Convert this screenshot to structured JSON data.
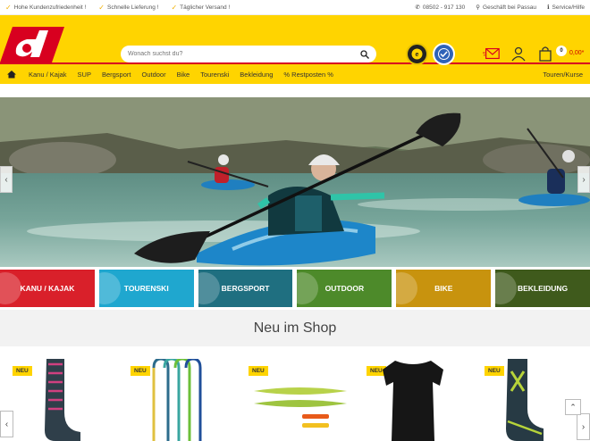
{
  "topbar": {
    "usps": [
      "Hohe Kundenzufriedenheit !",
      "Schnelle Lieferung !",
      "Täglicher Versand !"
    ],
    "phone": "08502 - 917 130",
    "store": "Geschäft bei Passau",
    "service": "Service/Hilfe"
  },
  "header": {
    "search_placeholder": "Wonach suchst du?",
    "cart_count": "0",
    "cart_total": "0,00*"
  },
  "nav": {
    "items": [
      "Kanu / Kajak",
      "SUP",
      "Bergsport",
      "Outdoor",
      "Bike",
      "Tourenski",
      "Bekleidung",
      "% Restposten %"
    ],
    "right": "Touren/Kurse"
  },
  "categories": [
    {
      "label": "KANU / KAJAK",
      "color": "#d9202a"
    },
    {
      "label": "TOURENSKI",
      "color": "#1fa7cf"
    },
    {
      "label": "BERGSPORT",
      "color": "#1f6f80"
    },
    {
      "label": "OUTDOOR",
      "color": "#4d8a2a"
    },
    {
      "label": "BIKE",
      "color": "#c8930e"
    },
    {
      "label": "BEKLEIDUNG",
      "color": "#3f5a1c"
    }
  ],
  "section_title": "Neu im Shop",
  "products": [
    {
      "badge": "NEU",
      "icon": "sock-icon"
    },
    {
      "badge": "NEU",
      "icon": "sling-icon"
    },
    {
      "badge": "NEU",
      "icon": "kayak-icon"
    },
    {
      "badge": "NEU",
      "icon": "shirt-icon"
    },
    {
      "badge": "NEU",
      "icon": "ski-sock-icon"
    }
  ],
  "colors": {
    "brand_yellow": "#ffd400",
    "brand_red": "#d8001f"
  }
}
